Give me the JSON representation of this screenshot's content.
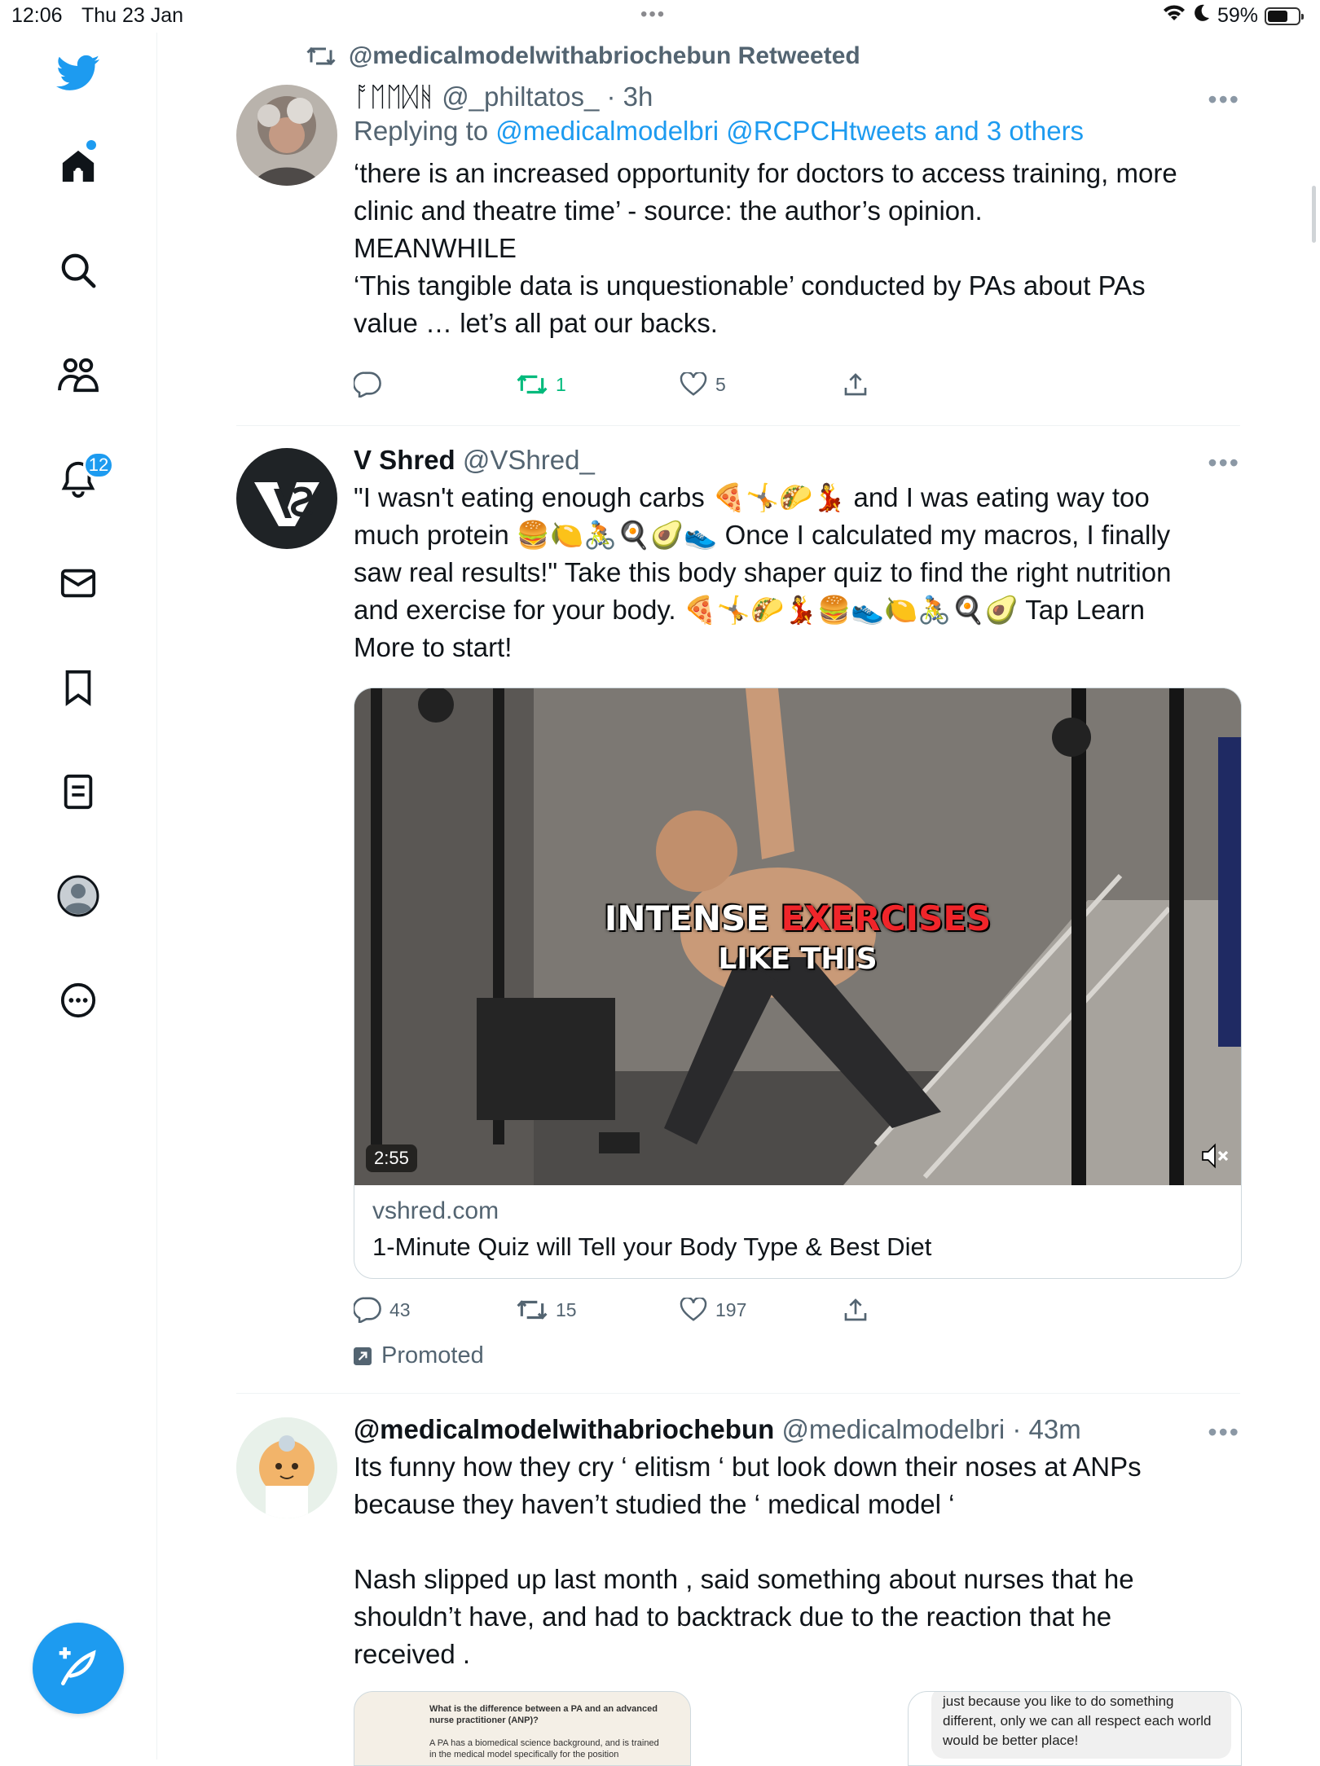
{
  "status_bar": {
    "time": "12:06",
    "date": "Thu 23 Jan",
    "dots": "•••",
    "battery": "59%",
    "battery_level": 0.59
  },
  "sidebar": {
    "items": [
      {
        "name": "twitter-logo"
      },
      {
        "name": "home"
      },
      {
        "name": "search"
      },
      {
        "name": "communities"
      },
      {
        "name": "notifications"
      },
      {
        "name": "messages"
      },
      {
        "name": "bookmarks"
      },
      {
        "name": "lists"
      },
      {
        "name": "profile"
      },
      {
        "name": "more"
      }
    ],
    "notifications_badge": "12",
    "compose_icon": "compose-feather-icon"
  },
  "tweets": [
    {
      "retweeted_by": "@medicalmodelwithabriochebun Retweeted",
      "display_name": "ᚩᛖᛖᛞᚻ",
      "handle": "@_philtatos_",
      "time": "· 3h",
      "replying_prefix": "Replying to",
      "replying_to": "@medicalmodelbri @RCPCHtweets and 3 others",
      "lines": [
        "‘there is an increased opportunity for doctors to access training, more",
        "clinic and theatre time’ - source: the author’s opinion.",
        "MEANWHILE",
        "‘This tangible data is unquestionable’ conducted by PAs about PAs",
        "value … let’s all pat our backs."
      ],
      "replies": "",
      "retweets": "1",
      "likes": "5"
    },
    {
      "display_name": "V Shred",
      "handle": "@VShred_",
      "lines": [
        "\"I wasn't eating enough carbs 🍕🤸🌮💃 and I was eating way too",
        "much protein 🍔🍋🚴🍳🥑👟  Once I calculated my macros, I finally",
        "saw real results!\" Take this body shaper quiz to find the right nutrition",
        "and exercise for your body. 🍕🤸🌮💃🍔👟🍋🚴🍳🥑 Tap Learn",
        "More to start!"
      ],
      "video_caption_1a": "INTENSE ",
      "video_caption_1b": "EXERCISES",
      "video_caption_2": "LIKE THIS",
      "video_duration": "2:55",
      "card_domain": "vshred.com",
      "card_title": "1-Minute Quiz will Tell your Body Type & Best Diet",
      "replies": "43",
      "retweets": "15",
      "likes": "197",
      "promoted": "Promoted"
    },
    {
      "display_name": "@medicalmodelwithabriochebun",
      "handle": "@medicalmodelbri",
      "time": "· 43m",
      "lines": [
        "Its funny how they cry ‘ elitism ‘ but look down their noses at ANPs",
        "because they haven’t studied the ‘ medical model ‘",
        "",
        "Nash slipped up last month , said something about nurses that he",
        "shouldn’t have, and had to backtrack due to the reaction that he",
        "received ."
      ],
      "attachment_1_question": "What is the difference between a PA and an advanced nurse practitioner (ANP)?",
      "attachment_1_text": "A PA has a biomedical science background, and is trained in the medical model specifically for the position",
      "attachment_2_text": "just because you like to do something different, only we can all respect each world would be better place!"
    }
  ]
}
